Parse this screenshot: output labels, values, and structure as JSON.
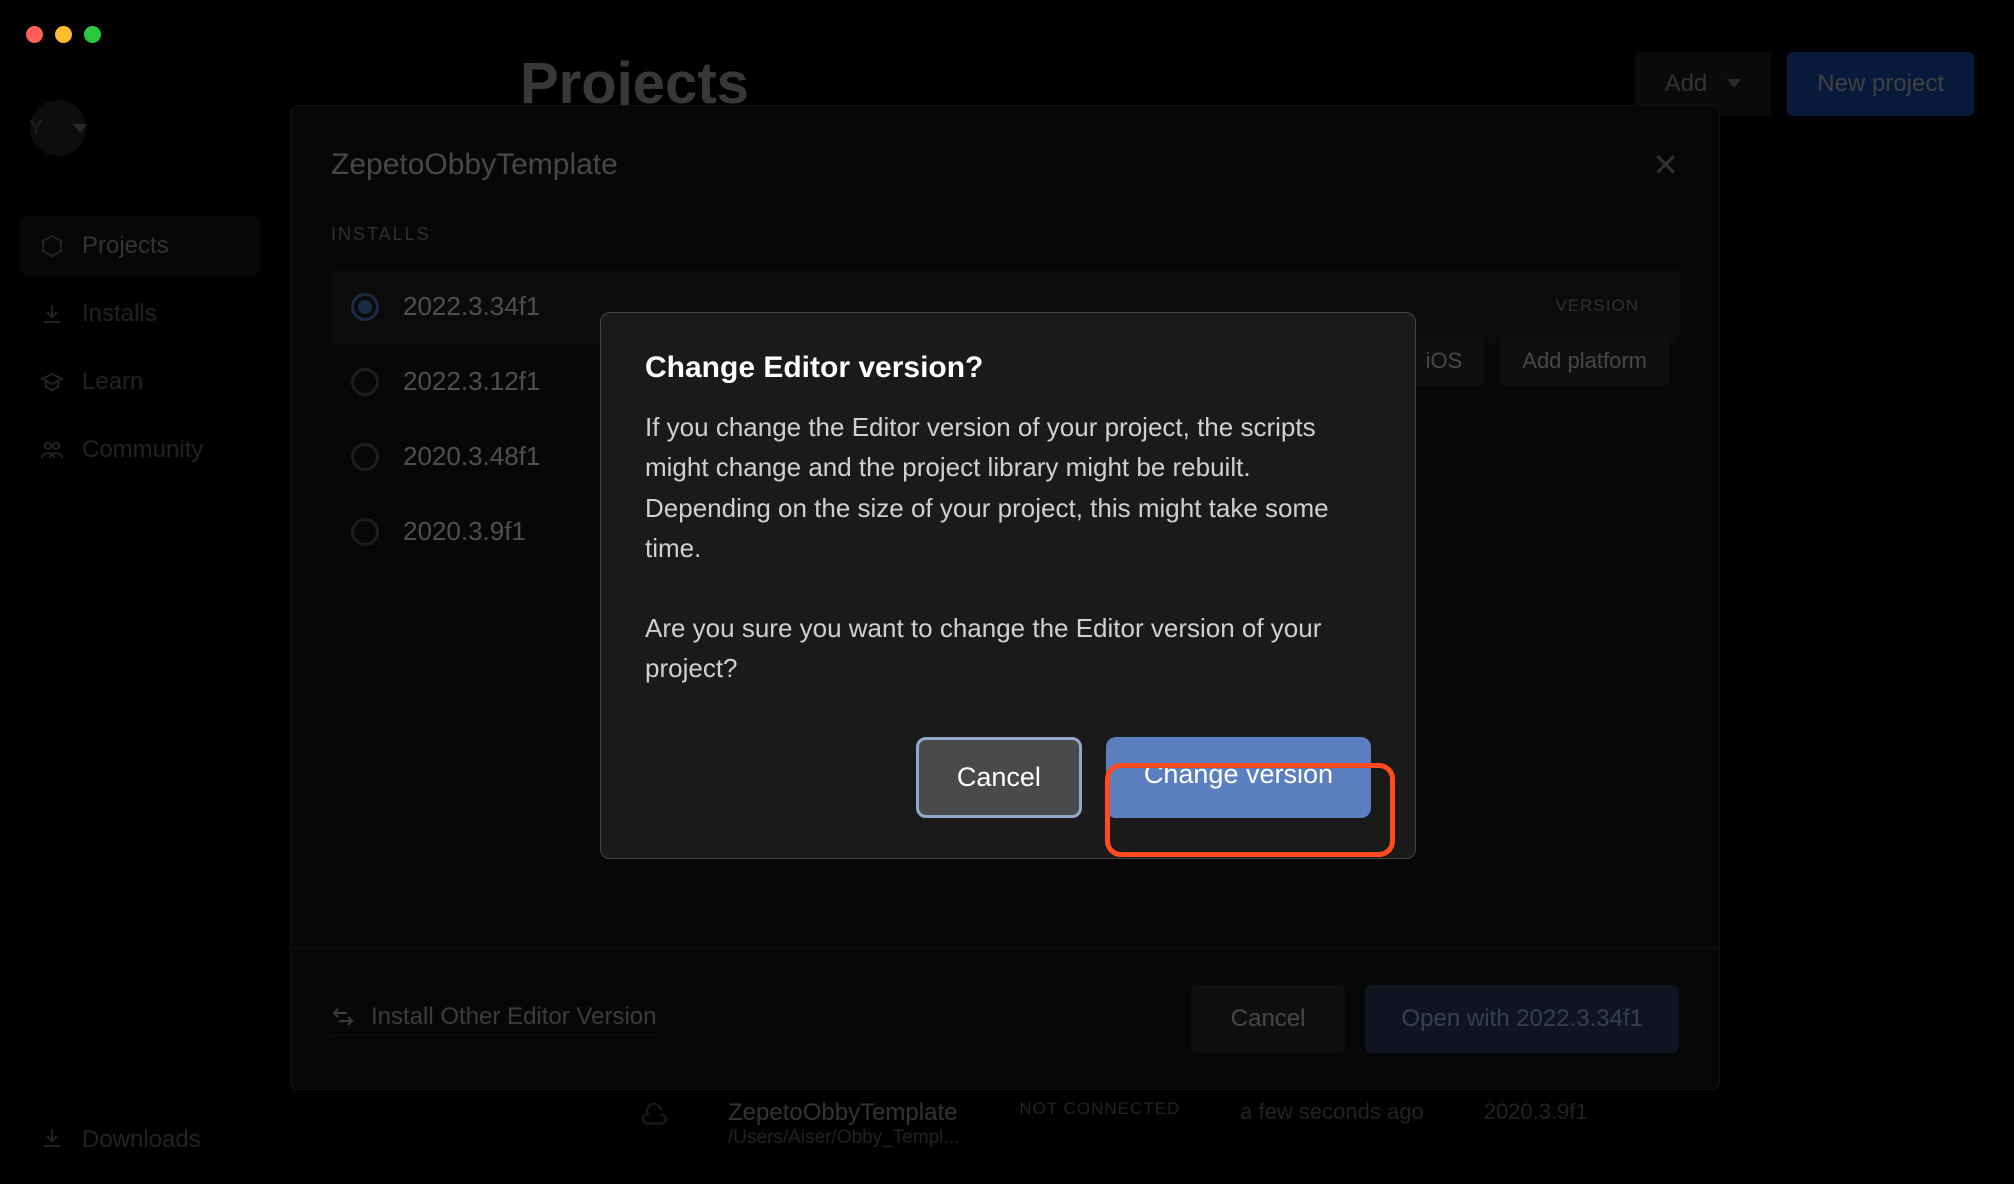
{
  "window": {
    "avatar_initial": "Y"
  },
  "sidebar": {
    "items": [
      {
        "label": "Projects"
      },
      {
        "label": "Installs"
      },
      {
        "label": "Learn"
      },
      {
        "label": "Community"
      }
    ],
    "downloads": "Downloads"
  },
  "header": {
    "title": "Projects",
    "add_label": "Add",
    "new_project_label": "New project"
  },
  "version_modal": {
    "title": "ZepetoObbyTemplate",
    "section_label": "INSTALLS",
    "column_version": "VERSION",
    "installs": [
      {
        "version": "2022.3.34f1",
        "selected": true
      },
      {
        "version": "2022.3.12f1",
        "selected": false
      },
      {
        "version": "2020.3.48f1",
        "selected": false
      },
      {
        "version": "2020.3.9f1",
        "selected": false
      }
    ],
    "platform_ios": "iOS",
    "add_platform": "Add platform",
    "install_other": "Install Other Editor Version",
    "cancel": "Cancel",
    "open_with": "Open with 2022.3.34f1"
  },
  "project_row": {
    "name": "ZepetoObbyTemplate",
    "path": "/Users/Aiser/Obby_Templ...",
    "status": "NOT CONNECTED",
    "modified": "a few seconds ago",
    "version": "2020.3.9f1"
  },
  "dialog": {
    "title": "Change Editor version?",
    "body1": "If you change the Editor version of your project, the scripts might change and the project library might be rebuilt. Depending on the size of your project, this might take some time.",
    "body2": "Are you sure you want to change the Editor version of your project?",
    "cancel": "Cancel",
    "confirm": "Change version"
  }
}
